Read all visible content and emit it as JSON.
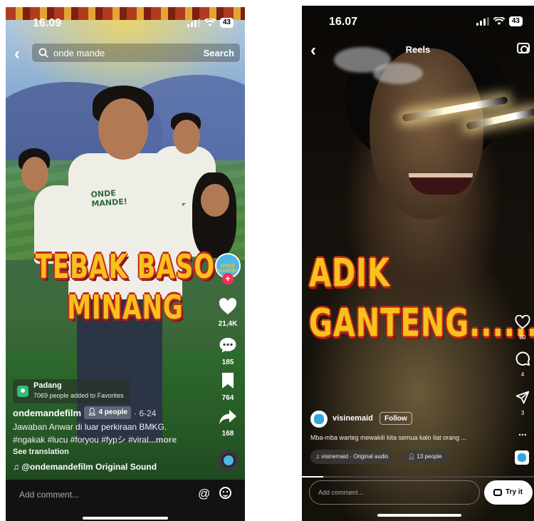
{
  "tiktok": {
    "status_time": "16.09",
    "battery": "43",
    "search_query": "onde mande",
    "search_button": "Search",
    "overlay_line1": "TEBAK BASO",
    "overlay_line2": "MINANG",
    "shirt_text": "ONDE MANDE!",
    "rail": {
      "avatar_text": "ONDE MANDE!",
      "likes": "21,4K",
      "comments": "185",
      "saves": "764",
      "shares": "168"
    },
    "location": {
      "title": "Padang",
      "subtitle": "7069 people added to Favorites"
    },
    "username": "ondemandefilm",
    "people_tag": "4 people",
    "date": "· 6-24",
    "desc_line1": "Jawaban Anwar di luar perkiraan BMKG.",
    "desc_line2": "#ngakak #lucu #foryou #fypシ #viral",
    "desc_more": "...more",
    "see_translation": "See translation",
    "sound": "♫ @ondemandefilm Original Sound",
    "comment_placeholder": "Add comment...",
    "icons": [
      "back-icon",
      "search-icon",
      "heart-icon",
      "comment-icon",
      "bookmark-icon",
      "share-icon",
      "at-icon",
      "emoji-icon",
      "location-pin-icon",
      "music-note-icon"
    ]
  },
  "reels": {
    "status_time": "16.07",
    "battery": "43",
    "title": "Reels",
    "overlay_line1": "ADIK",
    "overlay_line2": "GANTENG......",
    "rail": {
      "likes": "80",
      "comments": "4",
      "shares": "3",
      "more": "..."
    },
    "username": "visinemaid",
    "follow": "Follow",
    "description": "Mba-mba warteg mewakili kita semua kalo liat orang ...",
    "audio": "visinemaid · Original audio",
    "people": "13 people",
    "comment_placeholder": "Add comment...",
    "try_it": "Try it"
  }
}
